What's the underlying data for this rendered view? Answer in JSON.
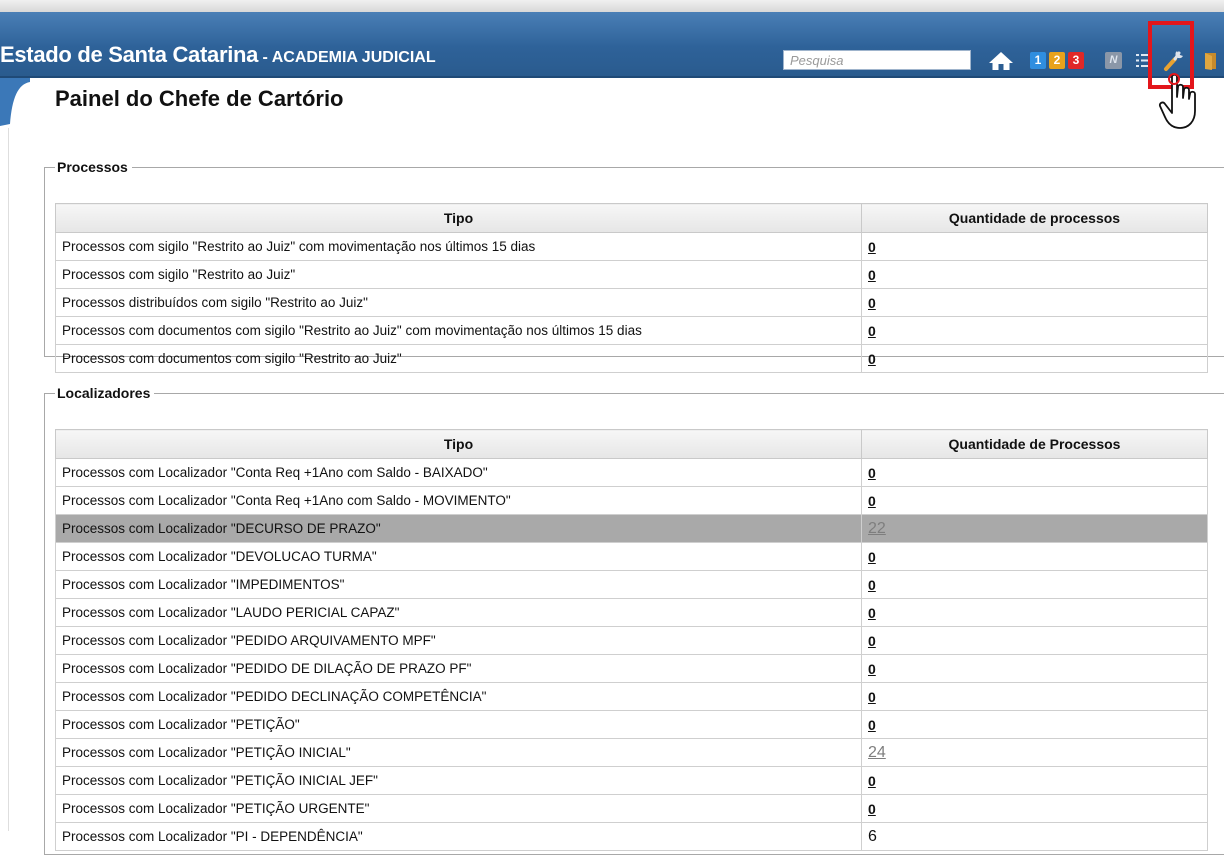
{
  "header": {
    "title": "Estado de Santa Catarina",
    "subtitle": " - ACADEMIA JUDICIAL",
    "search_placeholder": "Pesquisa",
    "badges": [
      "1",
      "2",
      "3"
    ],
    "n_label": "N"
  },
  "page_title": "Painel do Chefe de Cartório",
  "processos": {
    "legend": "Processos",
    "col_tipo": "Tipo",
    "col_qtd": "Quantidade de processos",
    "rows": [
      {
        "tipo": "Processos com sigilo \"Restrito ao Juiz\" com movimentação nos últimos 15 dias",
        "qtd": "0"
      },
      {
        "tipo": "Processos com sigilo \"Restrito ao Juiz\"",
        "qtd": "0"
      },
      {
        "tipo": "Processos distribuídos com sigilo \"Restrito ao Juiz\"",
        "qtd": "0"
      },
      {
        "tipo": "Processos com documentos com sigilo \"Restrito ao Juiz\" com movimentação nos últimos 15 dias",
        "qtd": "0"
      },
      {
        "tipo": "Processos com documentos com sigilo \"Restrito ao Juiz\"",
        "qtd": "0"
      }
    ]
  },
  "localizadores": {
    "legend": "Localizadores",
    "col_tipo": "Tipo",
    "col_qtd": "Quantidade de Processos",
    "rows": [
      {
        "tipo": "Processos com Localizador  \"Conta Req +1Ano com Saldo - BAIXADO\"",
        "qtd": "0"
      },
      {
        "tipo": "Processos com Localizador  \"Conta Req +1Ano com Saldo - MOVIMENTO\"",
        "qtd": "0"
      },
      {
        "tipo": "Processos com Localizador  \"DECURSO DE PRAZO\"",
        "qtd": "22"
      },
      {
        "tipo": "Processos com Localizador  \"DEVOLUCAO TURMA\"",
        "qtd": "0"
      },
      {
        "tipo": "Processos com Localizador  \"IMPEDIMENTOS\"",
        "qtd": "0"
      },
      {
        "tipo": "Processos com Localizador  \"LAUDO PERICIAL CAPAZ\"",
        "qtd": "0"
      },
      {
        "tipo": "Processos com Localizador  \"PEDIDO ARQUIVAMENTO MPF\"",
        "qtd": "0"
      },
      {
        "tipo": "Processos com Localizador  \"PEDIDO DE DILAÇÃO DE PRAZO PF\"",
        "qtd": "0"
      },
      {
        "tipo": "Processos com Localizador  \"PEDIDO DECLINAÇÃO COMPETÊNCIA\"",
        "qtd": "0"
      },
      {
        "tipo": "Processos com Localizador  \"PETIÇÃO\"",
        "qtd": "0"
      },
      {
        "tipo": "Processos com Localizador  \"PETIÇÃO INICIAL\"",
        "qtd": "24"
      },
      {
        "tipo": "Processos com Localizador  \"PETIÇÃO INICIAL JEF\"",
        "qtd": "0"
      },
      {
        "tipo": "Processos com Localizador  \"PETIÇÃO URGENTE\"",
        "qtd": "0"
      },
      {
        "tipo": "Processos com Localizador  \"PI - DEPENDÊNCIA\"",
        "qtd": "6"
      }
    ]
  },
  "colors": {
    "header_blue": "#2e6299",
    "highlight_red": "#e3161b",
    "selected_row": "#a9a9a9"
  },
  "icons": [
    "home-icon",
    "n-icon",
    "menu-icon",
    "wrench-icon",
    "exit-icon",
    "hand-cursor-icon"
  ]
}
